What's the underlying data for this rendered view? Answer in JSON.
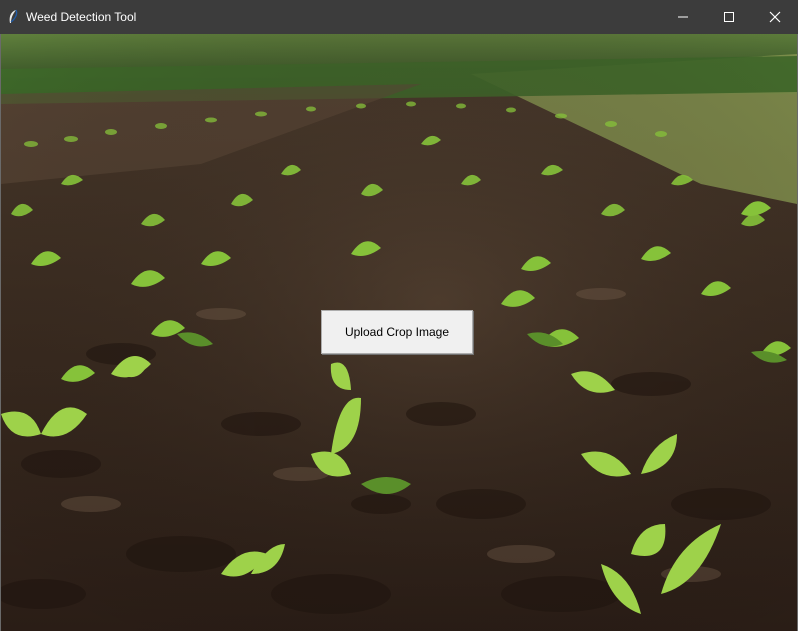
{
  "window": {
    "title": "Weed Detection Tool",
    "icon": "feather-icon",
    "controls": {
      "minimize_icon": "minimize-icon",
      "maximize_icon": "maximize-icon",
      "close_icon": "close-icon"
    }
  },
  "main": {
    "upload_button_label": "Upload Crop Image",
    "background": "crop-field-photo"
  },
  "colors": {
    "titlebar": "#3c3c3c",
    "button_face": "#f0f0f0",
    "soil": "#3a2b22",
    "leaf": "#8cc63f"
  }
}
